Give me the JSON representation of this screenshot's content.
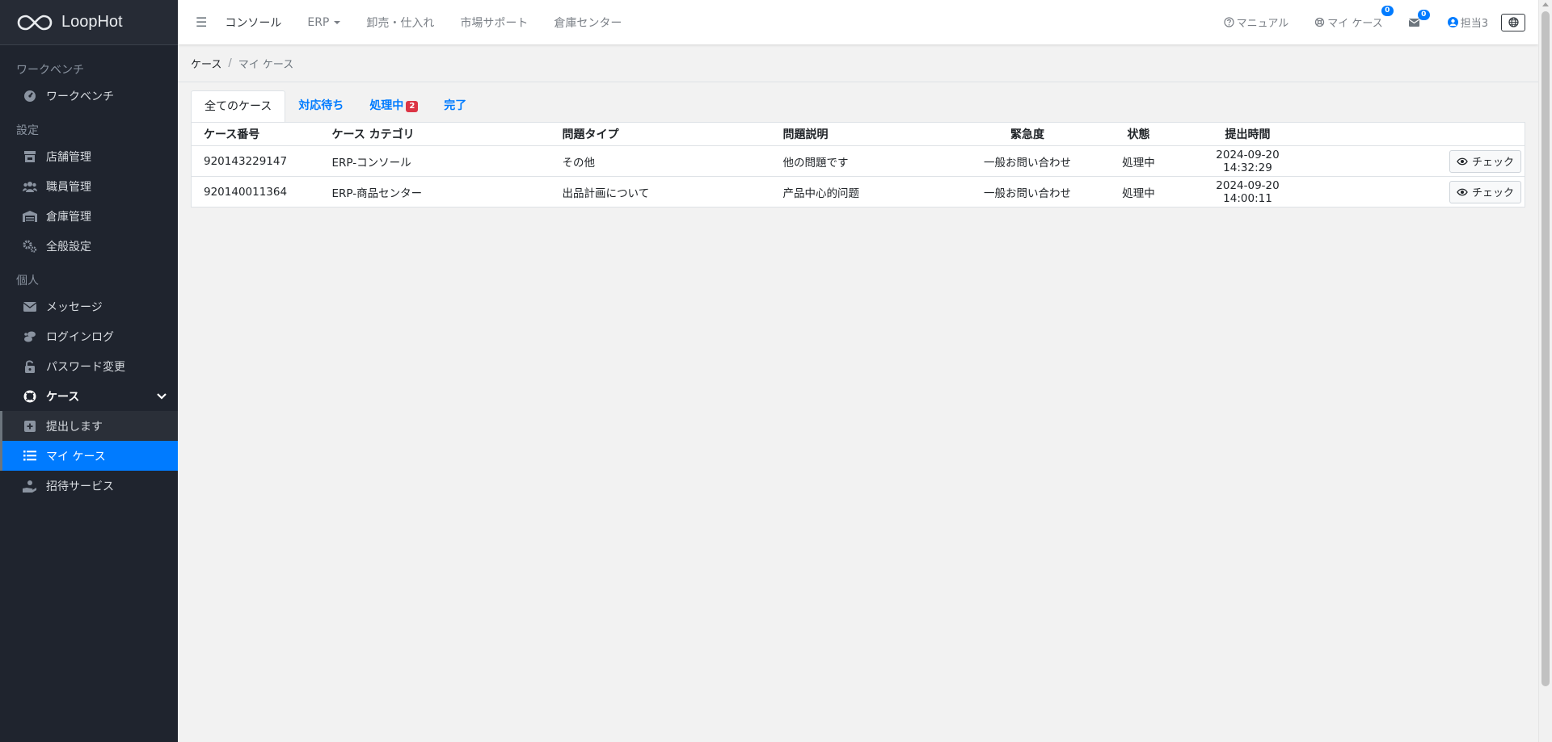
{
  "brand": {
    "name": "LoopHot"
  },
  "sidebar": {
    "sections": [
      {
        "label": "ワークベンチ",
        "items": [
          {
            "label": "ワークベンチ",
            "icon": "dashboard-icon"
          }
        ]
      },
      {
        "label": "設定",
        "items": [
          {
            "label": "店舗管理",
            "icon": "store-icon"
          },
          {
            "label": "職員管理",
            "icon": "users-icon"
          },
          {
            "label": "倉庫管理",
            "icon": "warehouse-icon"
          },
          {
            "label": "全般設定",
            "icon": "gears-icon"
          }
        ]
      },
      {
        "label": "個人",
        "items": [
          {
            "label": "メッセージ",
            "icon": "envelope-icon"
          },
          {
            "label": "ログインログ",
            "icon": "login-log-icon"
          },
          {
            "label": "パスワード変更",
            "icon": "unlock-icon"
          },
          {
            "label": "ケース",
            "icon": "lifering-icon"
          },
          {
            "label": "提出します",
            "icon": "plus-square-icon"
          },
          {
            "label": "マイ ケース",
            "icon": "list-icon"
          },
          {
            "label": "招待サービス",
            "icon": "hand-holding-icon"
          }
        ]
      }
    ]
  },
  "topbar": {
    "menu_icon": "☰",
    "nav": [
      "コンソール",
      "ERP",
      "卸売・仕入れ",
      "市場サポート",
      "倉庫センター"
    ],
    "manual": "マニュアル",
    "my_case": "マイ ケース",
    "my_case_count": "0",
    "mail_count": "0",
    "user": "担当3"
  },
  "breadcrumb": {
    "home": "ケース",
    "sep": "/",
    "current": "マイ ケース"
  },
  "tabs": [
    {
      "label": "全てのケース"
    },
    {
      "label": "対応待ち"
    },
    {
      "label": "処理中",
      "badge": "2"
    },
    {
      "label": "完了"
    }
  ],
  "table": {
    "headers": [
      "ケース番号",
      "ケース カテゴリ",
      "問題タイプ",
      "問題説明",
      "緊急度",
      "状態",
      "提出時間",
      ""
    ],
    "rows": [
      [
        "920143229147",
        "ERP-コンソール",
        "その他",
        "他の問題です",
        "一般お問い合わせ",
        "処理中",
        "2024-09-20 14:32:29",
        "チェック"
      ],
      [
        "920140011364",
        "ERP-商品センター",
        "出品計画について",
        "产品中心的问题",
        "一般お問い合わせ",
        "処理中",
        "2024-09-20 14:00:11",
        "チェック"
      ]
    ]
  },
  "colors": {
    "sidebar_bg": "#1f242e",
    "accent": "#007bff",
    "badge_red": "#dc3545"
  }
}
